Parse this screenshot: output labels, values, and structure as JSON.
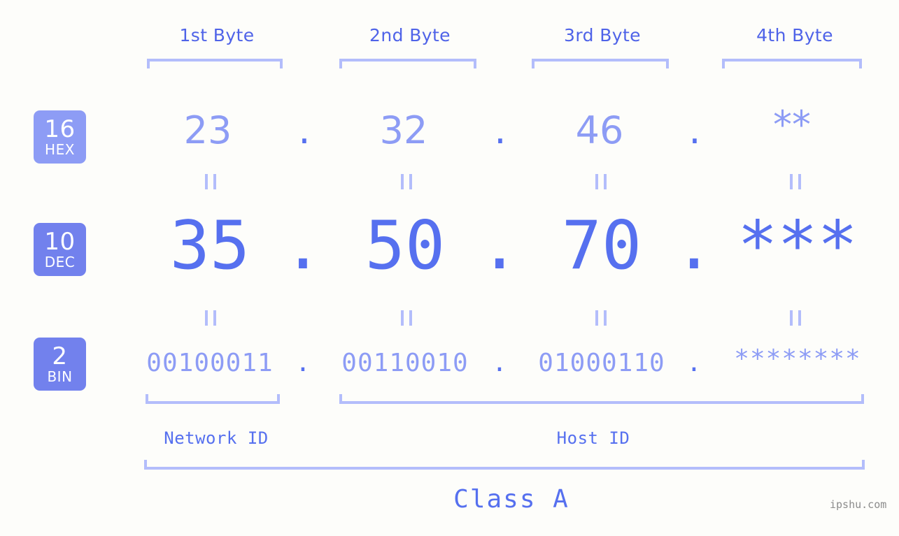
{
  "diagram": {
    "title": "IP address byte breakdown",
    "background_color": "#fdfdfa",
    "accent_color": "#5670ef",
    "accent_light_color": "#8d9cf5",
    "bracket_color": "#b3bdfb",
    "badge_color": "#7281ed"
  },
  "byte_headers": [
    {
      "label": "1st Byte"
    },
    {
      "label": "2nd Byte"
    },
    {
      "label": "3rd Byte"
    },
    {
      "label": "4th Byte"
    }
  ],
  "rows": [
    {
      "badge_number": "16",
      "badge_label": "HEX",
      "values": [
        "23",
        "32",
        "46",
        "**"
      ],
      "separator": "."
    },
    {
      "badge_number": "10",
      "badge_label": "DEC",
      "values": [
        "35",
        "50",
        "70",
        "***"
      ],
      "separator": "."
    },
    {
      "badge_number": "2",
      "badge_label": "BIN",
      "values": [
        "00100011",
        "00110010",
        "01000110",
        "********"
      ],
      "separator": "."
    }
  ],
  "equality_marks": {
    "symbol": "||",
    "count_per_row": 4
  },
  "sections": [
    {
      "label": "Network ID"
    },
    {
      "label": "Host ID"
    }
  ],
  "class_label": "Class A",
  "watermark": "ipshu.com"
}
